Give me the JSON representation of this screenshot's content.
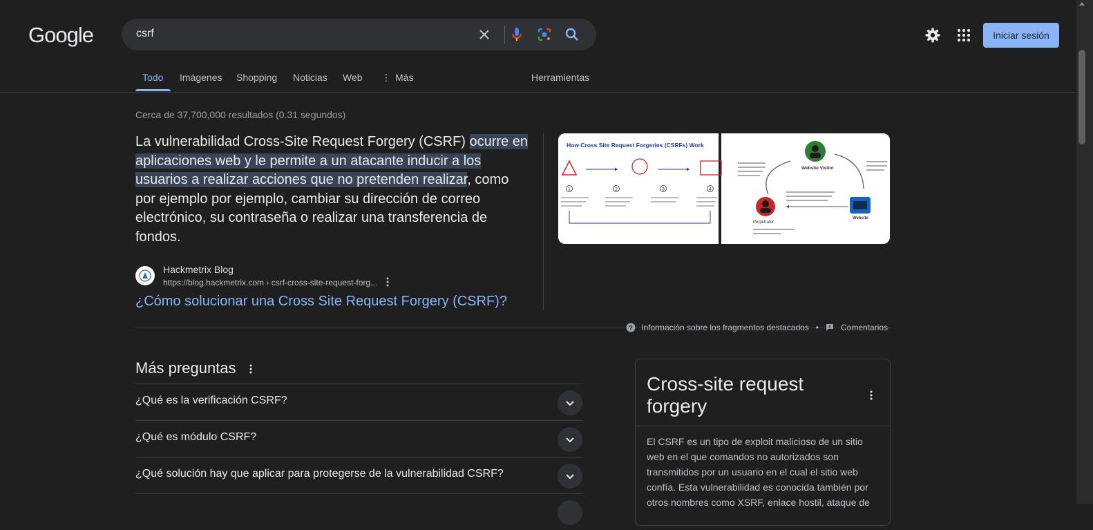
{
  "header": {
    "logo_text": "Google",
    "search_value": "csrf",
    "signin_label": "Iniciar sesión"
  },
  "tabs": [
    {
      "label": "Todo",
      "active": true
    },
    {
      "label": "Imágenes"
    },
    {
      "label": "Shopping"
    },
    {
      "label": "Noticias"
    },
    {
      "label": "Web"
    },
    {
      "label": "Más"
    }
  ],
  "tools_label": "Herramientas",
  "result_stats": "Cerca de 37,700,000 resultados (0.31 segundos)",
  "featured_snippet": {
    "text_before": "La vulnerabilidad Cross-Site Request Forgery (CSRF) ",
    "highlight": "ocurre en aplicaciones web y le permite a un atacante inducir a los usuarios a realizar acciones que no pretenden realizar",
    "text_after": ", como por ejemplo por ejemplo, cambiar su dirección de correo electrónico, su contraseña o realizar una transferencia de fondos.",
    "source_name": "Hackmetrix Blog",
    "source_url": "https://blog.hackmetrix.com › csrf-cross-site-request-forg...",
    "link_title": "¿Cómo solucionar una Cross Site Request Forgery (CSRF)?",
    "image": {
      "left_title": "How Cross Site Request Forgeries (CSRFs) Work",
      "steps": [
        "1",
        "2",
        "3",
        "4"
      ],
      "right_labels": {
        "visitor": "Website Visitor",
        "perpetrator": "Perpetrator",
        "website": "Website",
        "step2": "Perpetrator embeds the request into a hyperlink and sends it to visitors who may be logged into the site",
        "step4": "Website validates request and transfers funds from the visitor's account to the perpetrator",
        "step1": "Perpetrator forges a request for a fund transfer to a website"
      }
    }
  },
  "feedback": {
    "info_label": "Información sobre los fragmentos destacados",
    "separator": "•",
    "comments_label": "Comentarios"
  },
  "paa": {
    "title": "Más preguntas",
    "questions": [
      "¿Qué es la verificación CSRF?",
      "¿Qué es módulo CSRF?",
      "¿Qué solución hay que aplicar para protegerse de la vulnerabilidad CSRF?"
    ]
  },
  "knowledge_panel": {
    "title": "Cross-site request forgery",
    "description": "El CSRF es un tipo de exploit malicioso de un sitio web en el que comandos no autorizados son transmitidos por un usuario en el cual el sitio web confía. Esta vulnerabilidad es conocida también por otros nombres como XSRF, enlace hostil, ataque de"
  },
  "colors": {
    "background": "#1f1f1f",
    "link": "#8ab4f8",
    "highlight": "#394457"
  }
}
